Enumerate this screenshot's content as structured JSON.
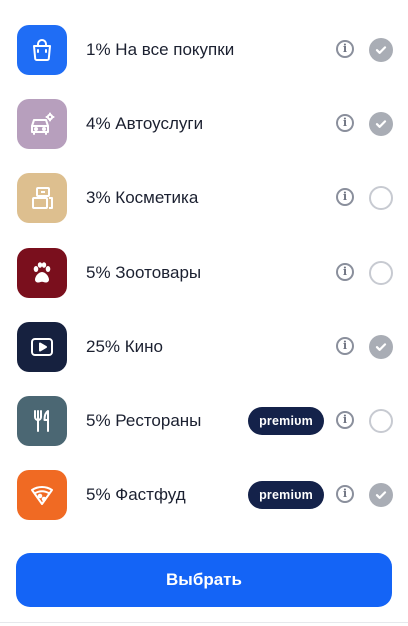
{
  "categories": [
    {
      "label": "1% На все покупки",
      "icon": "shopping-bag-icon",
      "color": "#1f6df5",
      "checked": true,
      "premium": false
    },
    {
      "label": "4% Автоуслуги",
      "icon": "car-service-icon",
      "color": "#b79fbd",
      "checked": true,
      "premium": false
    },
    {
      "label": "3% Косметика",
      "icon": "cosmetics-icon",
      "color": "#ddbf8f",
      "checked": false,
      "premium": false
    },
    {
      "label": "5% Зоотовары",
      "icon": "paw-icon",
      "color": "#7a0f1d",
      "checked": false,
      "premium": false
    },
    {
      "label": "25% Кино",
      "icon": "play-screen-icon",
      "color": "#16213f",
      "checked": true,
      "premium": false
    },
    {
      "label": "5% Рестораны",
      "icon": "fork-knife-icon",
      "color": "#4b6773",
      "checked": false,
      "premium": true
    },
    {
      "label": "5% Фастфуд",
      "icon": "pizza-icon",
      "color": "#f06a23",
      "checked": true,
      "premium": true
    }
  ],
  "premium_label": "premiυm",
  "info_glyph": "i",
  "select_button_label": "Выбрать",
  "colors": {
    "accent": "#1464f6",
    "premium_badge": "#14224a",
    "checked": "#a9adb5"
  }
}
